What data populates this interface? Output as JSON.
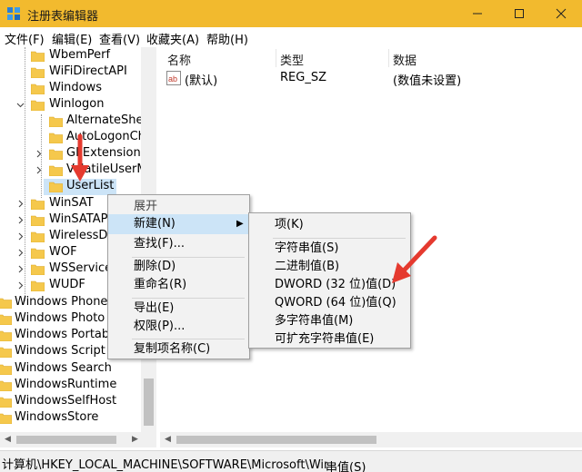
{
  "window": {
    "title": "注册表编辑器",
    "minimize_glyph": "—",
    "maximize_glyph": "☐",
    "close_glyph": "✕"
  },
  "menubar": [
    "文件(F)",
    "编辑(E)",
    "查看(V)",
    "收藏夹(A)",
    "帮助(H)"
  ],
  "tree": {
    "items": [
      {
        "label": "WbemPerf"
      },
      {
        "label": "WiFiDirectAPI"
      },
      {
        "label": "Windows"
      },
      {
        "label": "Winlogon"
      },
      {
        "label": "AlternateShel"
      },
      {
        "label": "AutoLogonCh"
      },
      {
        "label": "GPExtensions"
      },
      {
        "label": "VolatileUserM"
      },
      {
        "label": "UserList"
      },
      {
        "label": "WinSAT"
      },
      {
        "label": "WinSATAP"
      },
      {
        "label": "WirelessDa"
      },
      {
        "label": "WOF"
      },
      {
        "label": "WSService"
      },
      {
        "label": "WUDF"
      },
      {
        "label": "Windows Phone"
      },
      {
        "label": "Windows Photo"
      },
      {
        "label": "Windows Portab"
      },
      {
        "label": "Windows Script"
      },
      {
        "label": "Windows Search"
      },
      {
        "label": "WindowsRuntime"
      },
      {
        "label": "WindowsSelfHost"
      },
      {
        "label": "WindowsStore"
      }
    ]
  },
  "list": {
    "columns": [
      "名称",
      "类型",
      "数据"
    ],
    "rows": [
      {
        "name": "(默认)",
        "type": "REG_SZ",
        "data": "(数值未设置)"
      }
    ]
  },
  "context_menu": {
    "items": [
      "展开",
      "新建(N)",
      "查找(F)...",
      "删除(D)",
      "重命名(R)",
      "导出(E)",
      "权限(P)...",
      "复制项名称(C)"
    ]
  },
  "submenu": {
    "items": [
      "项(K)",
      "字符串值(S)",
      "二进制值(B)",
      "DWORD (32 位)值(D)",
      "QWORD (64 位)值(Q)",
      "多字符串值(M)",
      "可扩充字符串值(E)"
    ]
  },
  "statusbar": {
    "path": "计算机\\HKEY_LOCAL_MACHINE\\SOFTWARE\\Microsoft\\Windows NT\\CurrentVersion\\Winlogon\\UserList",
    "extra": "串值(S)"
  },
  "colors": {
    "titlebar": "#f2ba2e",
    "highlight": "#cce4f7",
    "annotation_arrow": "#e53a2f",
    "folder": "#f5c84c"
  }
}
